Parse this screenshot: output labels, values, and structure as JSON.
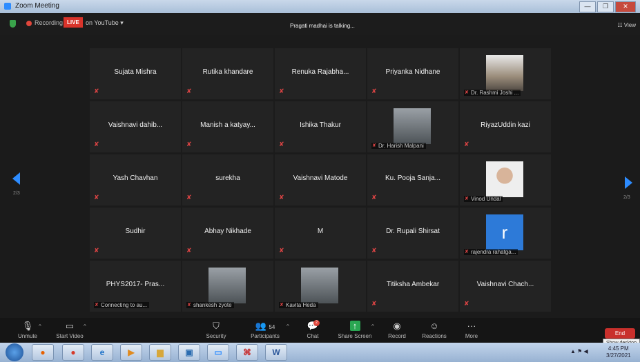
{
  "window": {
    "title": "Zoom Meeting",
    "btn_min": "—",
    "btn_max": "❐",
    "btn_close": "✕"
  },
  "topbar": {
    "recording": "Recording",
    "live": "LIVE",
    "stream": "on YouTube ▾",
    "talking": "Pragati madhai is talking...",
    "view": "View",
    "view_icon": "☷"
  },
  "paging": {
    "left": "2/3",
    "right": "2/3"
  },
  "participants": [
    {
      "name": "Sujata Mishra"
    },
    {
      "name": "Rutika khandare"
    },
    {
      "name": "Renuka  Rajabha..."
    },
    {
      "name": "Priyanka Nidhane"
    },
    {
      "name": "Dr. Rashmi Joshi ...",
      "photo": "sky"
    },
    {
      "name": "Vaishnavi  dahib..."
    },
    {
      "name": "Manish  a  katyay..."
    },
    {
      "name": "Ishika Thakur"
    },
    {
      "name": "Dr. Harish Malpani",
      "photo": "plain"
    },
    {
      "name": "RiyazUddin kazi"
    },
    {
      "name": "Yash Chavhan"
    },
    {
      "name": "surekha"
    },
    {
      "name": "Vaishnavi Matode"
    },
    {
      "name": "Ku.  Pooja Sanja..."
    },
    {
      "name": "Vinod Undal",
      "photo": "face"
    },
    {
      "name": "Sudhir"
    },
    {
      "name": "Abhay Nikhade"
    },
    {
      "name": "M"
    },
    {
      "name": "Dr. Rupali Shirsat"
    },
    {
      "name": "rajendra rahatga...",
      "photo": "avatar",
      "avatar_letter": "r"
    },
    {
      "name": "PHYS2017-  Pras...",
      "status": "Connecting to au..."
    },
    {
      "name": "shankesh zyote",
      "photo": "plain"
    },
    {
      "name": "Kavita Heda",
      "photo": "plain"
    },
    {
      "name": "Titiksha Ambekar"
    },
    {
      "name": "Vaishnavi  Chach..."
    }
  ],
  "toolbar": {
    "unmute": "Unmute",
    "start_video": "Start Video",
    "security": "Security",
    "participants": "Participants",
    "participants_count": "54",
    "chat": "Chat",
    "chat_badge": "2",
    "share_screen": "Share Screen",
    "record": "Record",
    "reactions": "Reactions",
    "more": "More",
    "end": "End",
    "show_desktop": "Show desktop"
  },
  "taskbar": {
    "apps": [
      "chrome-icon",
      "firefox-icon",
      "ie-icon",
      "media-icon",
      "folder-icon",
      "explorer-icon",
      "zoom-icon",
      "pdf-icon",
      "word-icon"
    ],
    "time": "4:45 PM",
    "date": "3/27/2021",
    "word_label": "W"
  }
}
